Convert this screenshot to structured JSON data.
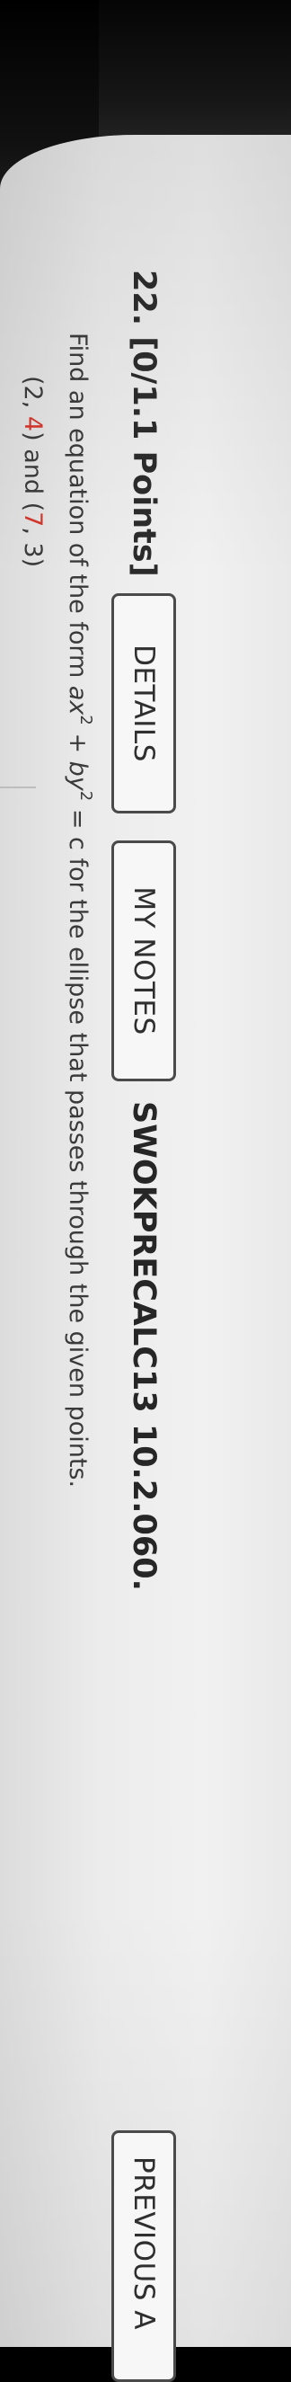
{
  "question": {
    "number_label": "22.",
    "points_label": "[0/1.1 Points]",
    "source_label": "SWOKPRECALC13 10.2.060."
  },
  "buttons": {
    "details": "DETAILS",
    "my_notes": "MY NOTES",
    "previous": "PREVIOUS A"
  },
  "prompt": {
    "text_1": "Find an equation of the form ",
    "a": "ax",
    "exp1": "2",
    "plus": " + ",
    "b": "by",
    "exp2": "2",
    "text_2": " = c for the ellipse that passes through the given points."
  },
  "given_points": {
    "p1_open": "(2, ",
    "p1_y": "4",
    "p1_close": ")",
    "and": " and ",
    "p2_open": "(",
    "p2_x": "7",
    "p2_close": ", 3)"
  },
  "colors": {
    "highlight_red": "#d0362c",
    "text": "#3a3a3a",
    "page_bg": "#f0f0f0"
  }
}
